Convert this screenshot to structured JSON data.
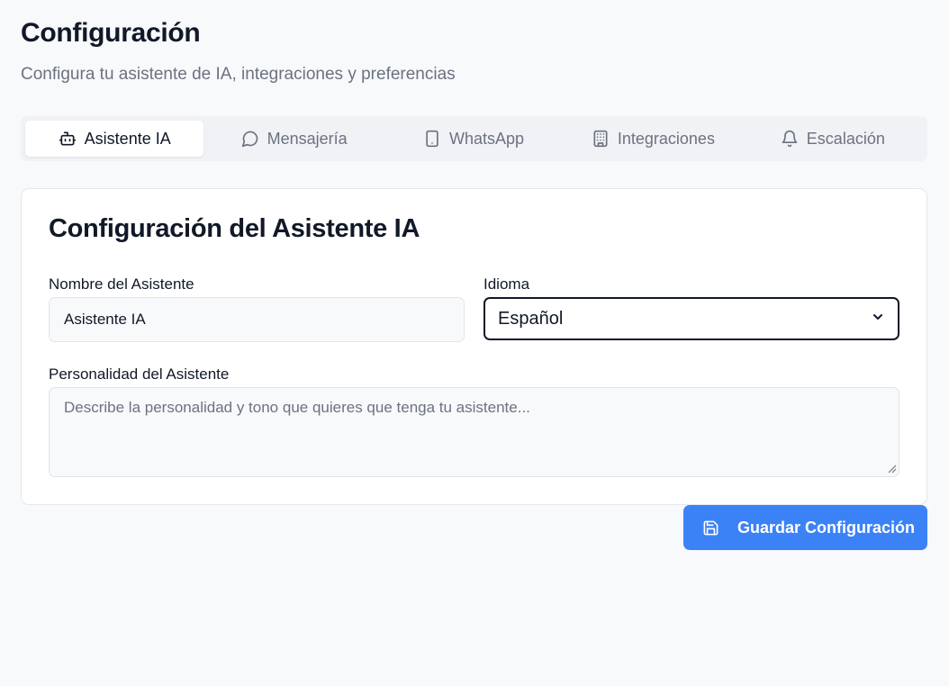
{
  "header": {
    "title": "Configuración",
    "subtitle": "Configura tu asistente de IA, integraciones y preferencias"
  },
  "tabs": [
    {
      "label": "Asistente IA",
      "icon": "bot-icon",
      "active": true
    },
    {
      "label": "Mensajería",
      "icon": "message-circle-icon",
      "active": false
    },
    {
      "label": "WhatsApp",
      "icon": "smartphone-icon",
      "active": false
    },
    {
      "label": "Integraciones",
      "icon": "building-icon",
      "active": false
    },
    {
      "label": "Escalación",
      "icon": "bell-icon",
      "active": false
    }
  ],
  "card": {
    "title": "Configuración del Asistente IA",
    "name_label": "Nombre del Asistente",
    "name_value": "Asistente IA",
    "language_label": "Idioma",
    "language_value": "Español",
    "personality_label": "Personalidad del Asistente",
    "personality_placeholder": "Describe la personalidad y tono que quieres que tenga tu asistente...",
    "personality_value": ""
  },
  "save_button": {
    "label": "Guardar Configuración",
    "icon": "save-icon"
  },
  "colors": {
    "accent": "#3b82f6",
    "background": "#f8f9fb",
    "muted_text": "#6b7280"
  }
}
